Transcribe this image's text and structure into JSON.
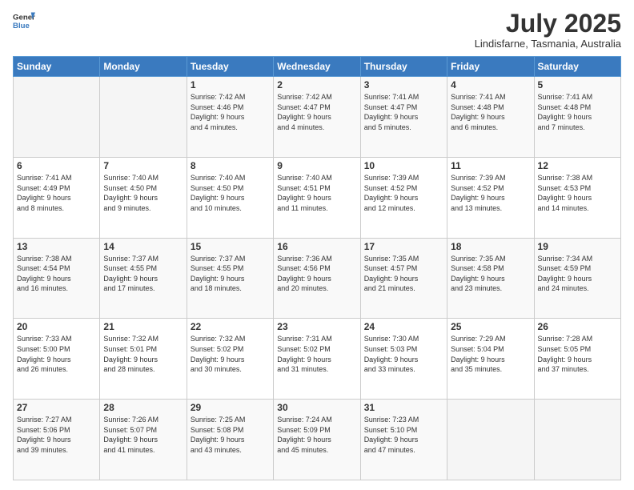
{
  "header": {
    "logo_general": "General",
    "logo_blue": "Blue",
    "month_year": "July 2025",
    "location": "Lindisfarne, Tasmania, Australia"
  },
  "days_of_week": [
    "Sunday",
    "Monday",
    "Tuesday",
    "Wednesday",
    "Thursday",
    "Friday",
    "Saturday"
  ],
  "weeks": [
    [
      {
        "day": "",
        "info": ""
      },
      {
        "day": "",
        "info": ""
      },
      {
        "day": "1",
        "info": "Sunrise: 7:42 AM\nSunset: 4:46 PM\nDaylight: 9 hours\nand 4 minutes."
      },
      {
        "day": "2",
        "info": "Sunrise: 7:42 AM\nSunset: 4:47 PM\nDaylight: 9 hours\nand 4 minutes."
      },
      {
        "day": "3",
        "info": "Sunrise: 7:41 AM\nSunset: 4:47 PM\nDaylight: 9 hours\nand 5 minutes."
      },
      {
        "day": "4",
        "info": "Sunrise: 7:41 AM\nSunset: 4:48 PM\nDaylight: 9 hours\nand 6 minutes."
      },
      {
        "day": "5",
        "info": "Sunrise: 7:41 AM\nSunset: 4:48 PM\nDaylight: 9 hours\nand 7 minutes."
      }
    ],
    [
      {
        "day": "6",
        "info": "Sunrise: 7:41 AM\nSunset: 4:49 PM\nDaylight: 9 hours\nand 8 minutes."
      },
      {
        "day": "7",
        "info": "Sunrise: 7:40 AM\nSunset: 4:50 PM\nDaylight: 9 hours\nand 9 minutes."
      },
      {
        "day": "8",
        "info": "Sunrise: 7:40 AM\nSunset: 4:50 PM\nDaylight: 9 hours\nand 10 minutes."
      },
      {
        "day": "9",
        "info": "Sunrise: 7:40 AM\nSunset: 4:51 PM\nDaylight: 9 hours\nand 11 minutes."
      },
      {
        "day": "10",
        "info": "Sunrise: 7:39 AM\nSunset: 4:52 PM\nDaylight: 9 hours\nand 12 minutes."
      },
      {
        "day": "11",
        "info": "Sunrise: 7:39 AM\nSunset: 4:52 PM\nDaylight: 9 hours\nand 13 minutes."
      },
      {
        "day": "12",
        "info": "Sunrise: 7:38 AM\nSunset: 4:53 PM\nDaylight: 9 hours\nand 14 minutes."
      }
    ],
    [
      {
        "day": "13",
        "info": "Sunrise: 7:38 AM\nSunset: 4:54 PM\nDaylight: 9 hours\nand 16 minutes."
      },
      {
        "day": "14",
        "info": "Sunrise: 7:37 AM\nSunset: 4:55 PM\nDaylight: 9 hours\nand 17 minutes."
      },
      {
        "day": "15",
        "info": "Sunrise: 7:37 AM\nSunset: 4:55 PM\nDaylight: 9 hours\nand 18 minutes."
      },
      {
        "day": "16",
        "info": "Sunrise: 7:36 AM\nSunset: 4:56 PM\nDaylight: 9 hours\nand 20 minutes."
      },
      {
        "day": "17",
        "info": "Sunrise: 7:35 AM\nSunset: 4:57 PM\nDaylight: 9 hours\nand 21 minutes."
      },
      {
        "day": "18",
        "info": "Sunrise: 7:35 AM\nSunset: 4:58 PM\nDaylight: 9 hours\nand 23 minutes."
      },
      {
        "day": "19",
        "info": "Sunrise: 7:34 AM\nSunset: 4:59 PM\nDaylight: 9 hours\nand 24 minutes."
      }
    ],
    [
      {
        "day": "20",
        "info": "Sunrise: 7:33 AM\nSunset: 5:00 PM\nDaylight: 9 hours\nand 26 minutes."
      },
      {
        "day": "21",
        "info": "Sunrise: 7:32 AM\nSunset: 5:01 PM\nDaylight: 9 hours\nand 28 minutes."
      },
      {
        "day": "22",
        "info": "Sunrise: 7:32 AM\nSunset: 5:02 PM\nDaylight: 9 hours\nand 30 minutes."
      },
      {
        "day": "23",
        "info": "Sunrise: 7:31 AM\nSunset: 5:02 PM\nDaylight: 9 hours\nand 31 minutes."
      },
      {
        "day": "24",
        "info": "Sunrise: 7:30 AM\nSunset: 5:03 PM\nDaylight: 9 hours\nand 33 minutes."
      },
      {
        "day": "25",
        "info": "Sunrise: 7:29 AM\nSunset: 5:04 PM\nDaylight: 9 hours\nand 35 minutes."
      },
      {
        "day": "26",
        "info": "Sunrise: 7:28 AM\nSunset: 5:05 PM\nDaylight: 9 hours\nand 37 minutes."
      }
    ],
    [
      {
        "day": "27",
        "info": "Sunrise: 7:27 AM\nSunset: 5:06 PM\nDaylight: 9 hours\nand 39 minutes."
      },
      {
        "day": "28",
        "info": "Sunrise: 7:26 AM\nSunset: 5:07 PM\nDaylight: 9 hours\nand 41 minutes."
      },
      {
        "day": "29",
        "info": "Sunrise: 7:25 AM\nSunset: 5:08 PM\nDaylight: 9 hours\nand 43 minutes."
      },
      {
        "day": "30",
        "info": "Sunrise: 7:24 AM\nSunset: 5:09 PM\nDaylight: 9 hours\nand 45 minutes."
      },
      {
        "day": "31",
        "info": "Sunrise: 7:23 AM\nSunset: 5:10 PM\nDaylight: 9 hours\nand 47 minutes."
      },
      {
        "day": "",
        "info": ""
      },
      {
        "day": "",
        "info": ""
      }
    ]
  ]
}
